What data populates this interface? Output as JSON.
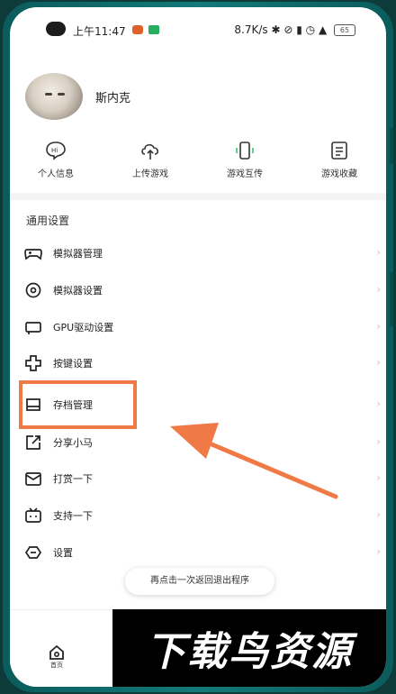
{
  "status_bar": {
    "time": "上午11:47",
    "right_text": "8.7K/s",
    "battery": "65"
  },
  "profile": {
    "name": "斯内克"
  },
  "quick_actions": [
    {
      "label": "个人信息",
      "icon": "hi-bubble-icon"
    },
    {
      "label": "上传游戏",
      "icon": "cloud-upload-icon"
    },
    {
      "label": "游戏互传",
      "icon": "phone-transfer-icon"
    },
    {
      "label": "游戏收藏",
      "icon": "list-document-icon"
    }
  ],
  "settings": {
    "section_title": "通用设置",
    "items": [
      {
        "label": "模拟器管理",
        "icon": "gamepad-icon"
      },
      {
        "label": "模拟器设置",
        "icon": "settings-gear-icon"
      },
      {
        "label": "GPU驱动设置",
        "icon": "gpu-card-icon"
      },
      {
        "label": "按键设置",
        "icon": "dpad-icon"
      },
      {
        "label": "存档管理",
        "icon": "save-archive-icon"
      },
      {
        "label": "分享小马",
        "icon": "share-icon"
      },
      {
        "label": "打赏一下",
        "icon": "envelope-icon"
      },
      {
        "label": "支持一下",
        "icon": "tv-support-icon"
      },
      {
        "label": "设置",
        "icon": "settings-icon"
      }
    ]
  },
  "toast": "再点击一次返回退出程序",
  "nav": {
    "home_label": "首页"
  },
  "watermark": "下载鸟资源",
  "colors": {
    "highlight": "#f07a45",
    "phone_frame": "#0b5c5c"
  }
}
